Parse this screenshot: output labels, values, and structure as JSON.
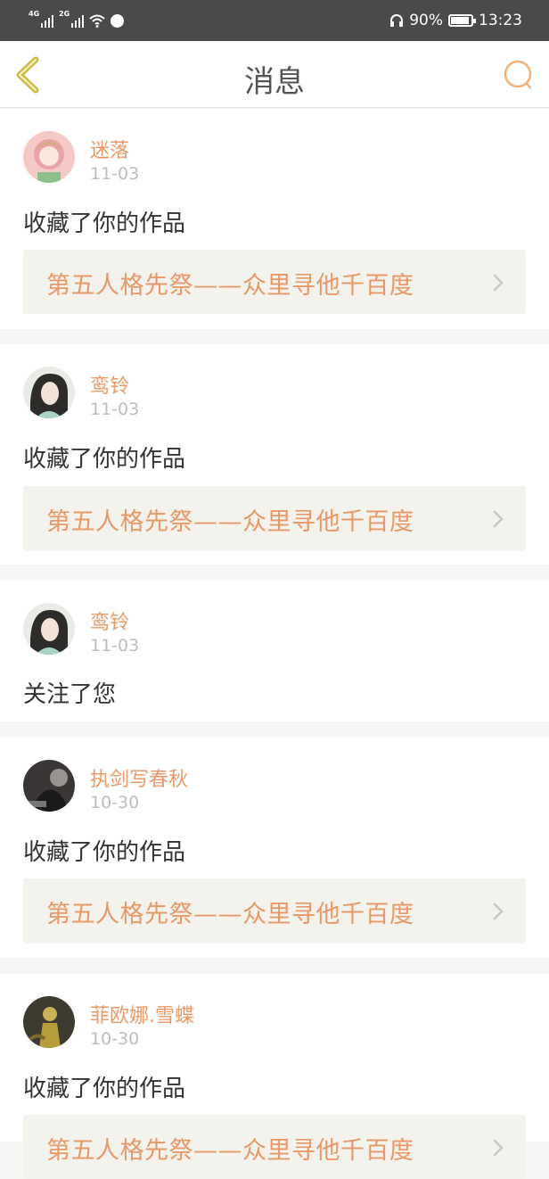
{
  "status_bar": {
    "net1": "4G",
    "net2": "2G",
    "battery_text": "90%",
    "battery_level": 0.9,
    "time": "13:23"
  },
  "header": {
    "title": "消息"
  },
  "icons": {
    "back": "chevron-left-icon",
    "search": "search-icon",
    "forward": "chevron-right-icon"
  },
  "colors": {
    "accent": "#e8996a",
    "status_bar_bg": "#4a4a4a",
    "back_icon": "#c7ba42",
    "search_icon": "#f0b078",
    "work_bg": "#f3f2ec"
  },
  "messages": [
    {
      "user": "迷落",
      "date": "11-03",
      "action": "收藏了你的作品",
      "work": "第五人格先祭——众里寻他千百度"
    },
    {
      "user": "鸾铃",
      "date": "11-03",
      "action": "收藏了你的作品",
      "work": "第五人格先祭——众里寻他千百度"
    },
    {
      "user": "鸾铃",
      "date": "11-03",
      "action": "关注了您"
    },
    {
      "user": "执剑写春秋",
      "date": "10-30",
      "action": "收藏了你的作品",
      "work": "第五人格先祭——众里寻他千百度"
    },
    {
      "user": "菲欧娜.雪蝶",
      "date": "10-30",
      "action": "收藏了你的作品",
      "work": "第五人格先祭——众里寻他千百度"
    }
  ]
}
